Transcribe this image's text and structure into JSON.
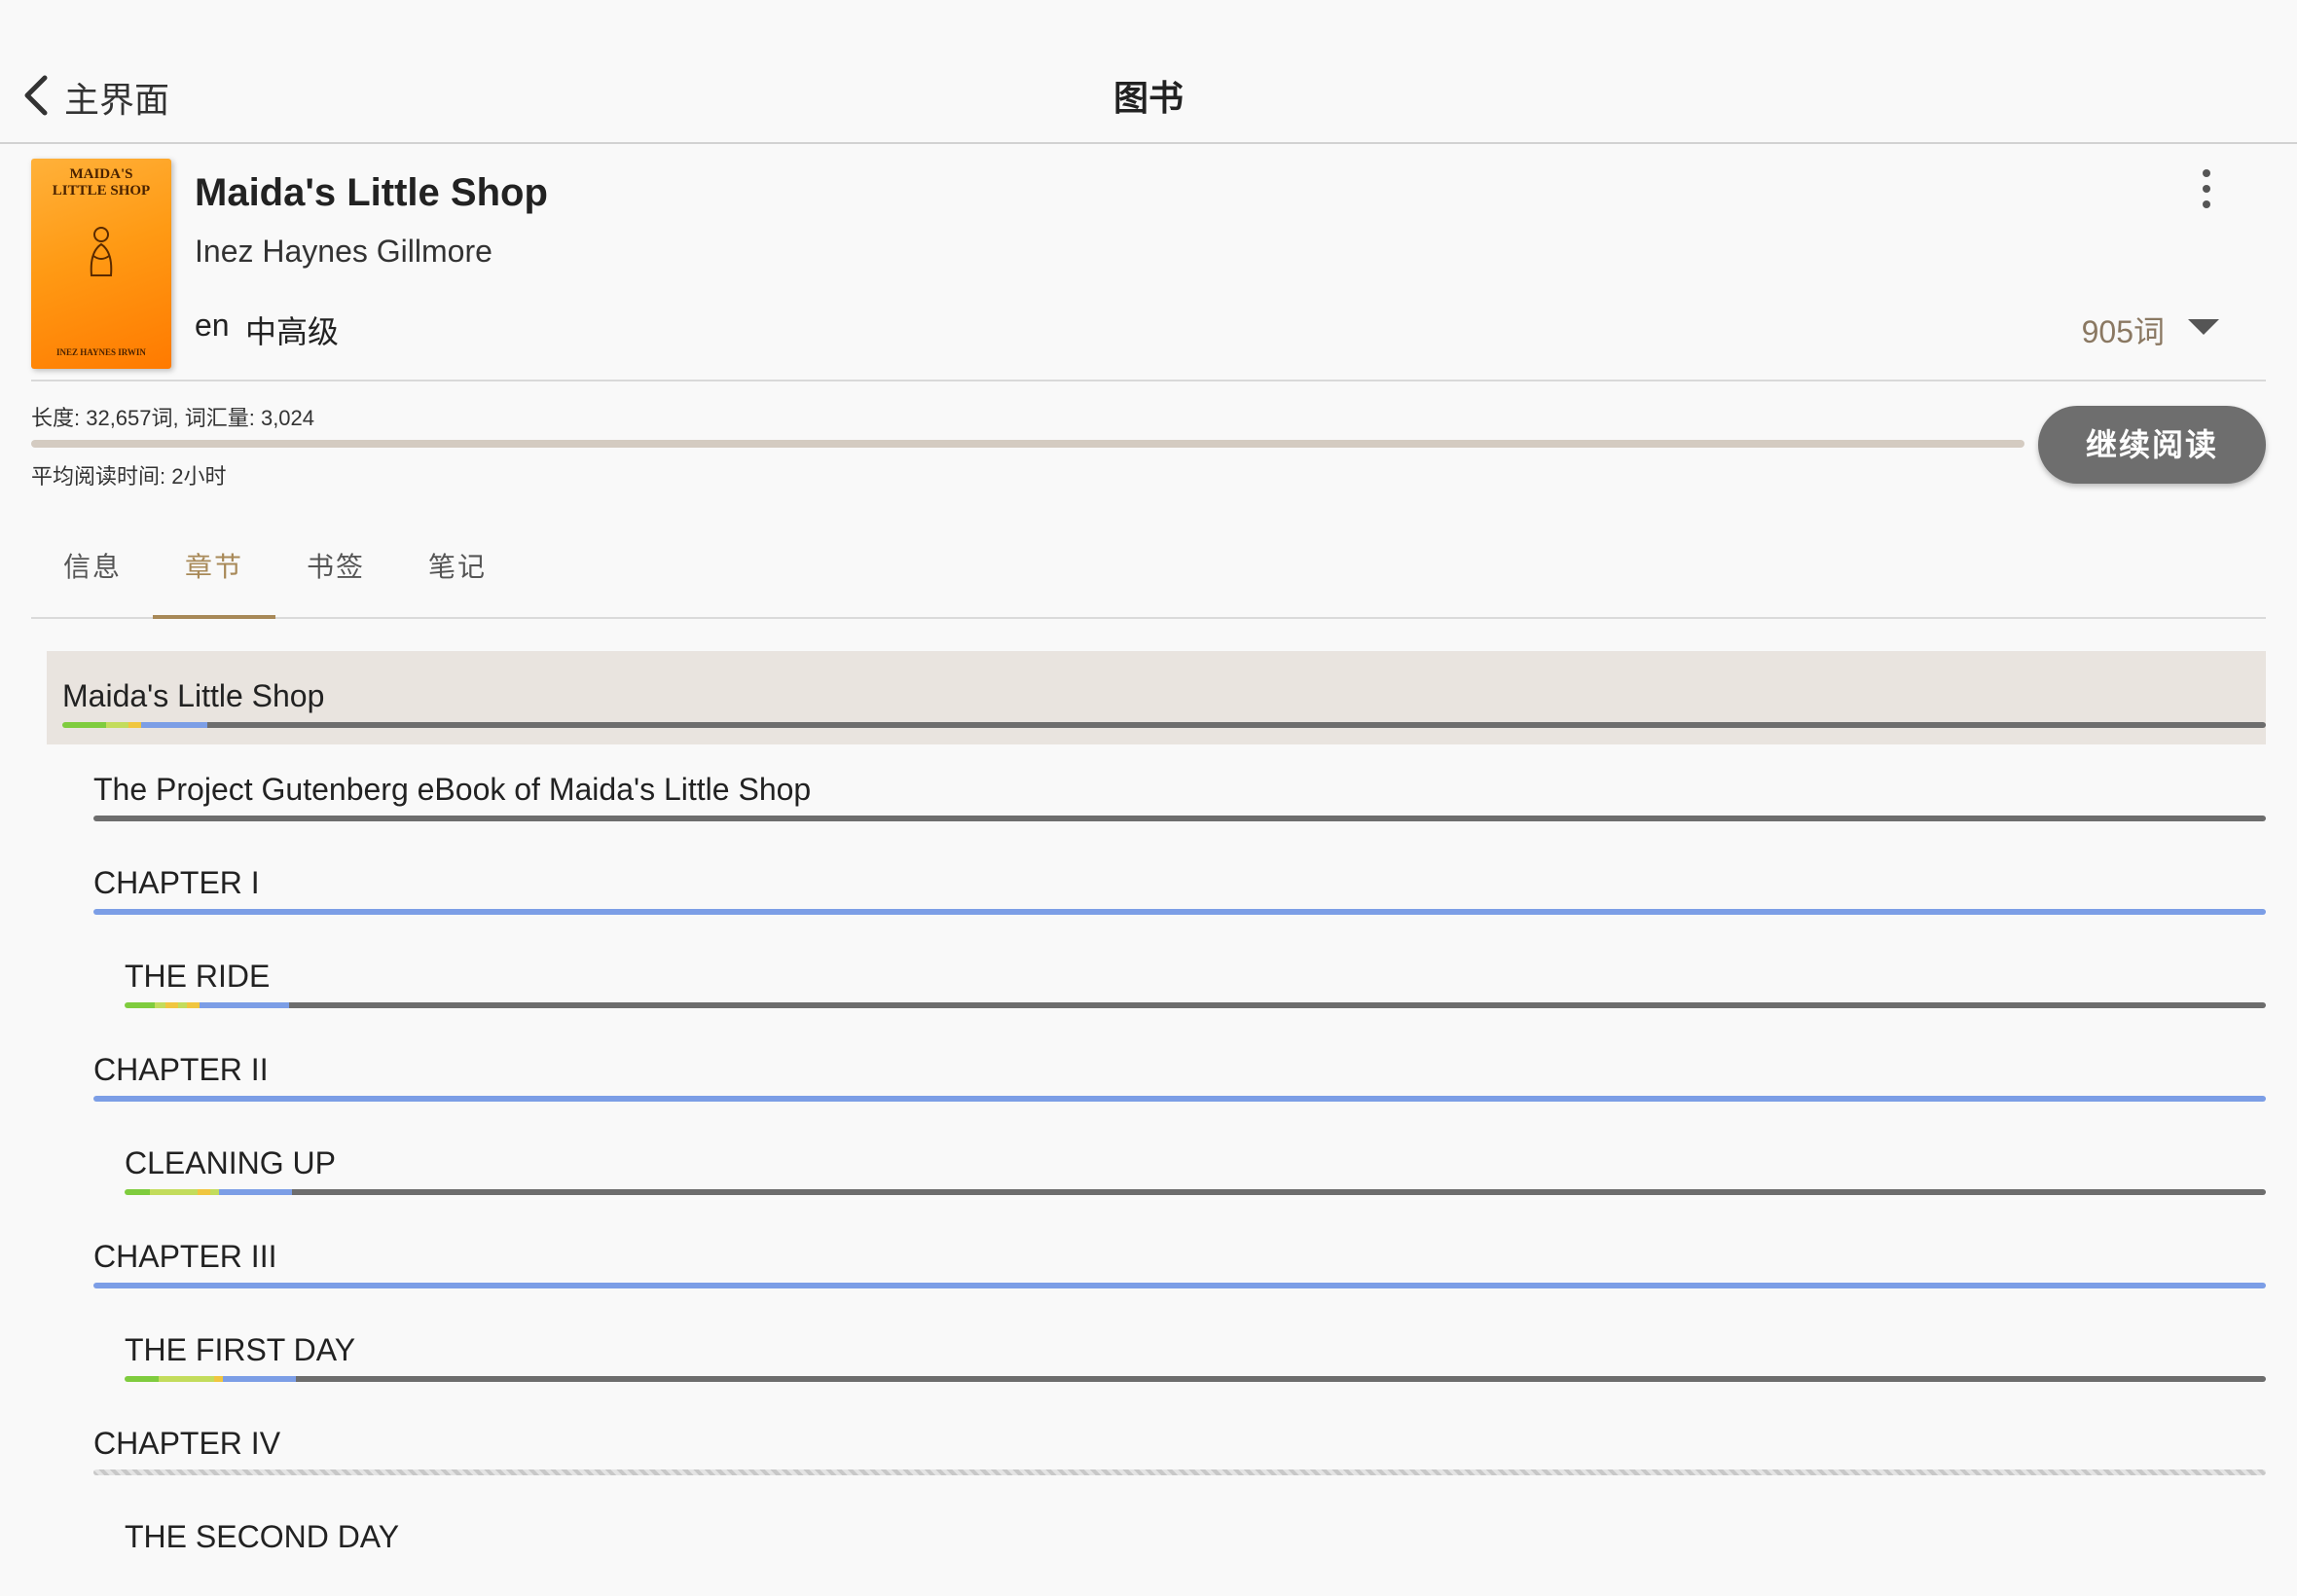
{
  "nav": {
    "back_label": "主界面",
    "title": "图书"
  },
  "book": {
    "title": "Maida's Little Shop",
    "author": "Inez Haynes Gillmore",
    "language": "en",
    "level": "中高级",
    "word_count": "905词",
    "cover": {
      "title_text": "MAIDA'S\nLITTLE SHOP",
      "author_text": "INEZ HAYNES IRWIN"
    }
  },
  "stats": {
    "length_text": "长度: 32,657词, 词汇量: 3,024",
    "read_time_text": "平均阅读时间: 2小时",
    "continue_label": "继续阅读"
  },
  "tabs": [
    {
      "label": "信息",
      "active": false
    },
    {
      "label": "章节",
      "active": true
    },
    {
      "label": "书签",
      "active": false
    },
    {
      "label": "笔记",
      "active": false
    }
  ],
  "chapters": [
    {
      "label": "Maida's Little Shop",
      "level": 0,
      "selected": true,
      "segments": [
        [
          "green",
          2
        ],
        [
          "lime",
          1
        ],
        [
          "yellow",
          0.6
        ],
        [
          "blue",
          3
        ],
        [
          "gray",
          93.4
        ]
      ]
    },
    {
      "label": "The Project Gutenberg eBook of Maida's Little Shop",
      "level": 1,
      "segments": [
        [
          "gray",
          100
        ]
      ]
    },
    {
      "label": "CHAPTER I",
      "level": 1,
      "segments": [
        [
          "blue",
          100
        ]
      ]
    },
    {
      "label": "THE RIDE",
      "level": 2,
      "segments": [
        [
          "green",
          1.4
        ],
        [
          "lime",
          0.5
        ],
        [
          "yellow",
          0.6
        ],
        [
          "lime",
          0.4
        ],
        [
          "yellow",
          0.6
        ],
        [
          "blue",
          4.2
        ],
        [
          "gray",
          92.3
        ]
      ]
    },
    {
      "label": "CHAPTER II",
      "level": 1,
      "segments": [
        [
          "blue",
          100
        ]
      ]
    },
    {
      "label": "CLEANING UP",
      "level": 2,
      "segments": [
        [
          "green",
          1.2
        ],
        [
          "lime",
          2.2
        ],
        [
          "yellow",
          0.6
        ],
        [
          "lime",
          0.4
        ],
        [
          "blue",
          3.4
        ],
        [
          "gray",
          92.2
        ]
      ]
    },
    {
      "label": "CHAPTER III",
      "level": 1,
      "segments": [
        [
          "blue",
          100
        ]
      ]
    },
    {
      "label": "THE FIRST DAY",
      "level": 2,
      "segments": [
        [
          "green",
          1.6
        ],
        [
          "lime",
          2.6
        ],
        [
          "yellow",
          0.4
        ],
        [
          "blue",
          3.4
        ],
        [
          "gray",
          92
        ]
      ]
    },
    {
      "label": "CHAPTER IV",
      "level": 1,
      "segments": [
        [
          "hatch",
          100
        ]
      ]
    },
    {
      "label": "THE SECOND DAY",
      "level": 2,
      "segments": []
    }
  ],
  "colors": {
    "accent": "#a88958",
    "progress_blue": "#7c9ee6",
    "unread_gray": "#6d6d6d"
  }
}
